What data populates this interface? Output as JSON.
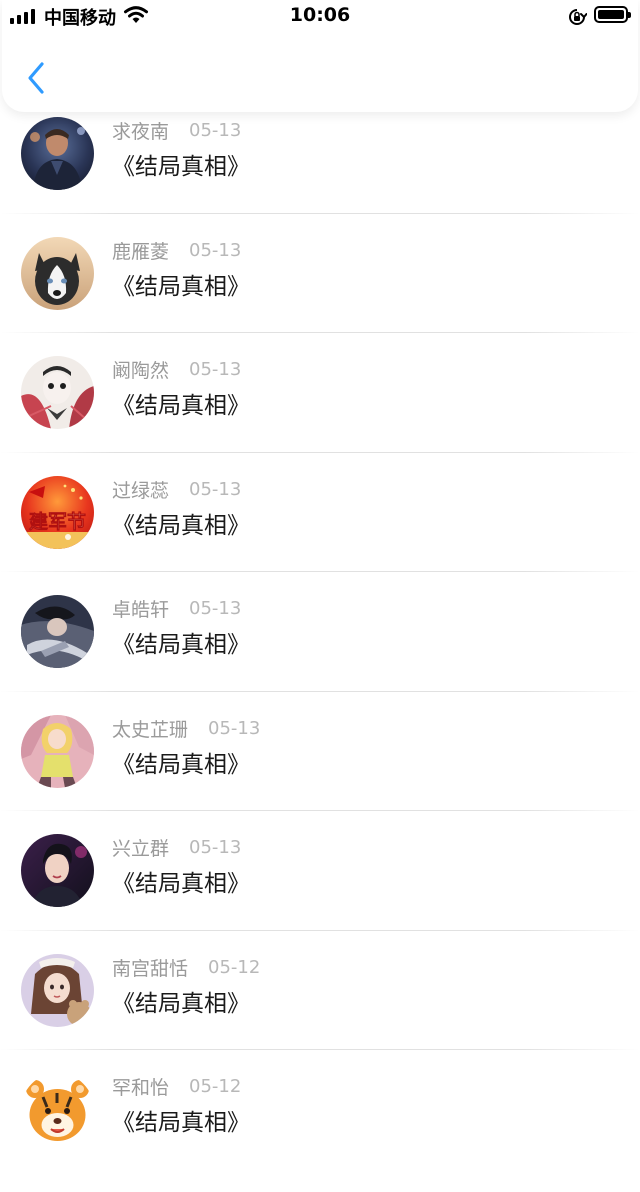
{
  "status_bar": {
    "carrier": "中国移动",
    "time": "10:06"
  },
  "comments": [
    {
      "name": "求夜南",
      "date": "05-13",
      "title": "《结局真相》",
      "avatar": "man-portrait-avatar"
    },
    {
      "name": "鹿雁菱",
      "date": "05-13",
      "title": "《结局真相》",
      "avatar": "husky-dog-avatar"
    },
    {
      "name": "阚陶然",
      "date": "05-13",
      "title": "《结局真相》",
      "avatar": "anime-character-avatar"
    },
    {
      "name": "过绿蕊",
      "date": "05-13",
      "title": "《结局真相》",
      "avatar": "jianjunjie-avatar",
      "avatar_text": "建军节"
    },
    {
      "name": "卓皓轩",
      "date": "05-13",
      "title": "《结局真相》",
      "avatar": "anime-boy-avatar"
    },
    {
      "name": "太史芷珊",
      "date": "05-13",
      "title": "《结局真相》",
      "avatar": "anime-girl-avatar"
    },
    {
      "name": "兴立群",
      "date": "05-13",
      "title": "《结局真相》",
      "avatar": "young-man-avatar"
    },
    {
      "name": "南宫甜恬",
      "date": "05-12",
      "title": "《结局真相》",
      "avatar": "illustrated-girl-avatar"
    },
    {
      "name": "罕和怡",
      "date": "05-12",
      "title": "《结局真相》",
      "avatar": "tiger-cartoon-avatar"
    }
  ],
  "colors": {
    "back_accent": "#2f9bff",
    "name": "#9a9a9a",
    "date": "#b8b8b8",
    "title": "#1a1a1a"
  }
}
